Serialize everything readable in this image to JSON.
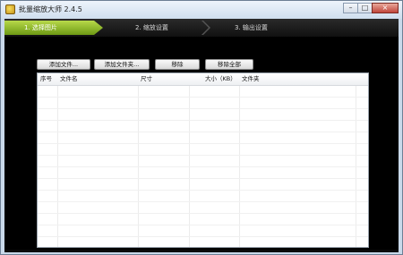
{
  "window": {
    "title": "批量缩放大师 2.4.5",
    "controls": {
      "minimize": "–",
      "maximize": "□",
      "close": "×"
    }
  },
  "steps": [
    {
      "label": "1. 选择图片",
      "active": true
    },
    {
      "label": "2. 缩放设置",
      "active": false
    },
    {
      "label": "3. 输出设置",
      "active": false
    }
  ],
  "toolbar": {
    "add_file": "添加文件...",
    "add_folder": "添加文件夹...",
    "remove": "移除",
    "remove_all": "移除全部"
  },
  "file_list": {
    "columns": [
      "序号",
      "文件名",
      "尺寸",
      "大小（KB）",
      "文件夹"
    ],
    "rows": []
  },
  "colors": {
    "accent_green": "#8fbc2a",
    "client_bg": "#000000",
    "title_bar": "#cfdeee"
  },
  "icons": {
    "app": "app-logo-icon"
  }
}
